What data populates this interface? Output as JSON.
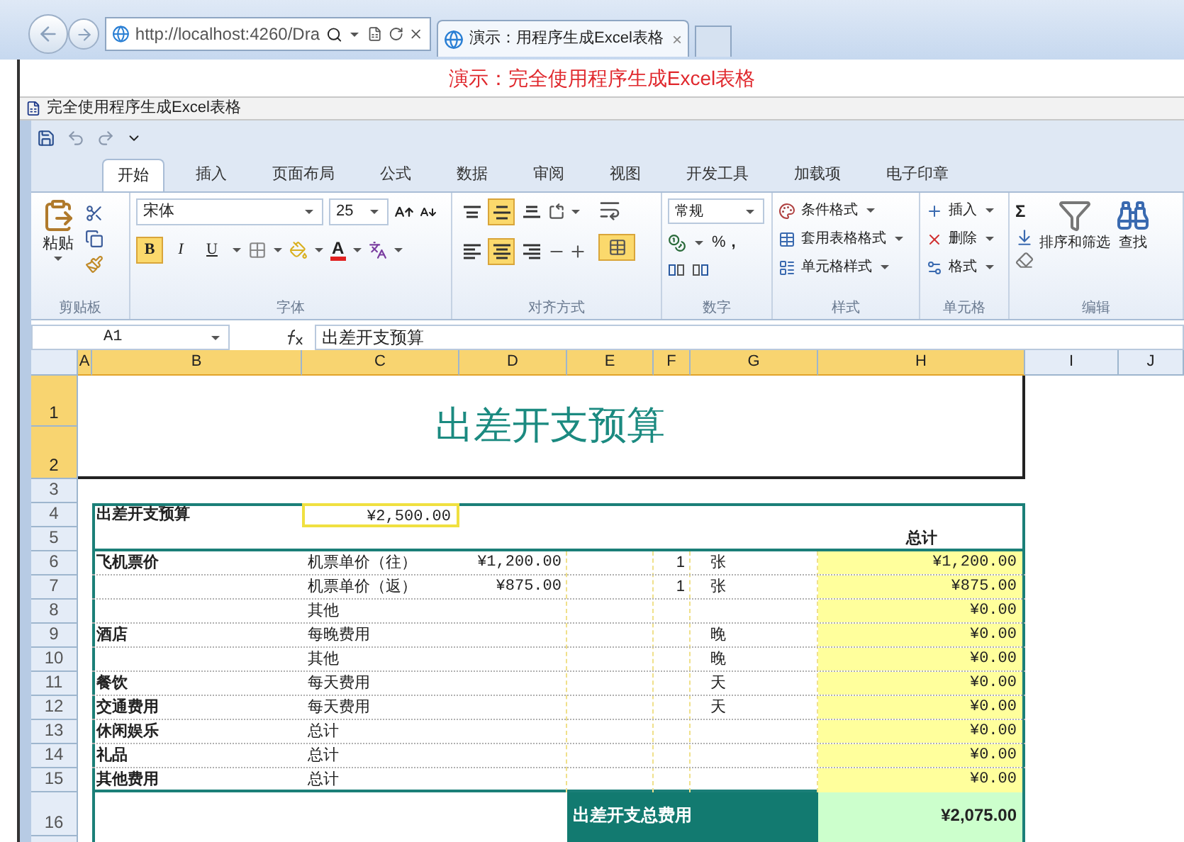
{
  "browser": {
    "address": "http://localhost:4260/Dra",
    "tab_title": "演示：用程序生成Excel表格",
    "tab_close": "×"
  },
  "page_heading": "演示：完全使用程序生成Excel表格",
  "document_title": "完全使用程序生成Excel表格",
  "ribbon": {
    "tabs": [
      {
        "label": "开始",
        "selected": true
      },
      {
        "label": "插入",
        "selected": false
      },
      {
        "label": "页面布局",
        "selected": false
      },
      {
        "label": "公式",
        "selected": false
      },
      {
        "label": "数据",
        "selected": false
      },
      {
        "label": "审阅",
        "selected": false
      },
      {
        "label": "视图",
        "selected": false
      },
      {
        "label": "开发工具",
        "selected": false
      },
      {
        "label": "加载项",
        "selected": false
      },
      {
        "label": "电子印章",
        "selected": false
      }
    ],
    "clipboard": {
      "paste": "粘贴",
      "group_label": "剪贴板"
    },
    "font": {
      "font_name": "宋体",
      "font_size": "25",
      "buttons": [
        {
          "kind": "bold",
          "label": "B",
          "active": true
        },
        {
          "kind": "italic",
          "label": "I",
          "active": false
        },
        {
          "kind": "underline",
          "label": "U",
          "active": false
        }
      ],
      "font_color_label": "A",
      "group_label": "字体"
    },
    "alignment": {
      "vertical": [
        {
          "kind": "top",
          "active": false
        },
        {
          "kind": "middle",
          "active": true
        },
        {
          "kind": "bottom",
          "active": false
        }
      ],
      "horizontal": [
        {
          "kind": "left",
          "active": false
        },
        {
          "kind": "center",
          "active": true
        },
        {
          "kind": "right",
          "active": false
        }
      ],
      "merge_active": true,
      "group_label": "对齐方式"
    },
    "number": {
      "format": "常规",
      "percent": "%",
      "comma": ",",
      "group_label": "数字"
    },
    "styles": {
      "items": [
        "条件格式",
        "套用表格格式",
        "单元格样式"
      ],
      "group_label": "样式"
    },
    "cells": {
      "items": [
        "插入",
        "删除",
        "格式"
      ],
      "group_label": "单元格"
    },
    "editing": {
      "sum": "Σ",
      "sort_filter": "排序和筛选",
      "find": "查找",
      "group_label": "编辑"
    }
  },
  "formula_bar": {
    "name_box": "A1",
    "content": "出差开支预算"
  },
  "sheet": {
    "columns": [
      {
        "label": "A",
        "selected": true
      },
      {
        "label": "B",
        "selected": true
      },
      {
        "label": "C",
        "selected": true
      },
      {
        "label": "D",
        "selected": true
      },
      {
        "label": "E",
        "selected": true
      },
      {
        "label": "F",
        "selected": true
      },
      {
        "label": "G",
        "selected": true
      },
      {
        "label": "H",
        "selected": true
      },
      {
        "label": "I",
        "selected": false
      },
      {
        "label": "J",
        "selected": false
      }
    ],
    "row_headers": [
      {
        "label": "1",
        "selected": true
      },
      {
        "label": "2",
        "selected": true
      },
      {
        "label": "3",
        "selected": false
      },
      {
        "label": "4",
        "selected": false
      },
      {
        "label": "5",
        "selected": false
      },
      {
        "label": "6",
        "selected": false
      },
      {
        "label": "7",
        "selected": false
      },
      {
        "label": "8",
        "selected": false
      },
      {
        "label": "9",
        "selected": false
      },
      {
        "label": "10",
        "selected": false
      },
      {
        "label": "11",
        "selected": false
      },
      {
        "label": "12",
        "selected": false
      },
      {
        "label": "13",
        "selected": false
      },
      {
        "label": "14",
        "selected": false
      },
      {
        "label": "15",
        "selected": false
      },
      {
        "label": "16",
        "selected": false
      }
    ],
    "title": "出差开支预算",
    "budget_label": "出差开支预算",
    "budget_value": "¥2,500.00",
    "total_header": "总计",
    "items": [
      {
        "category": "飞机票价",
        "item": "机票单价（往）",
        "price": "¥1,200.00",
        "quantity": "1",
        "unit": "张",
        "total": "¥1,200.00"
      },
      {
        "item": "机票单价（返）",
        "price": "¥875.00",
        "quantity": "1",
        "unit": "张",
        "total": "¥875.00"
      },
      {
        "item": "其他",
        "total": "¥0.00"
      },
      {
        "category": "酒店",
        "item": "每晚费用",
        "unit": "晚",
        "total": "¥0.00"
      },
      {
        "item": "其他",
        "unit": "晚",
        "total": "¥0.00"
      },
      {
        "category": "餐饮",
        "item": "每天费用",
        "unit": "天",
        "total": "¥0.00"
      },
      {
        "category": "交通费用",
        "item": "每天费用",
        "unit": "天",
        "total": "¥0.00"
      },
      {
        "category": "休闲娱乐",
        "item": "总计",
        "total": "¥0.00"
      },
      {
        "category": "礼品",
        "item": "总计",
        "total": "¥0.00"
      },
      {
        "category": "其他费用",
        "item": "总计",
        "total": "¥0.00"
      }
    ],
    "summary": {
      "label": "出差开支总费用",
      "value": "¥2,075.00"
    }
  }
}
